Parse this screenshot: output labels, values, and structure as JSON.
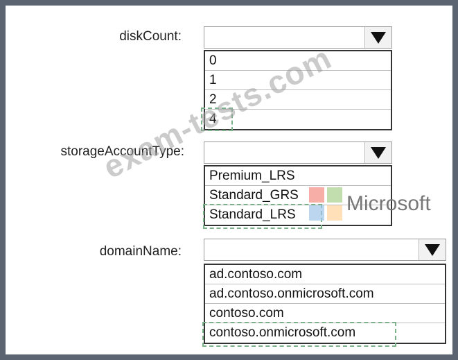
{
  "fields": [
    {
      "label": "diskCount:",
      "options": [
        "0",
        "1",
        "2",
        "4"
      ],
      "selected": "4"
    },
    {
      "label": "storageAccountType:",
      "options": [
        "Premium_LRS",
        "Standard_GRS",
        "Standard_LRS"
      ],
      "selected": "Standard_LRS"
    },
    {
      "label": "domainName:",
      "options": [
        "ad.contoso.com",
        "ad.contoso.onmicrosoft.com",
        "contoso.com",
        "contoso.onmicrosoft.com"
      ],
      "selected": "contoso.onmicrosoft.com"
    }
  ],
  "watermark": {
    "text": "exam-tests.com",
    "logo_text": "Microsoft",
    "logo_colors": [
      "#f28b82",
      "#a8d08d",
      "#9fc5e8",
      "#ffd39a"
    ]
  },
  "colors": {
    "selection_dash": "#7ab08a",
    "background": "#5b6470"
  }
}
